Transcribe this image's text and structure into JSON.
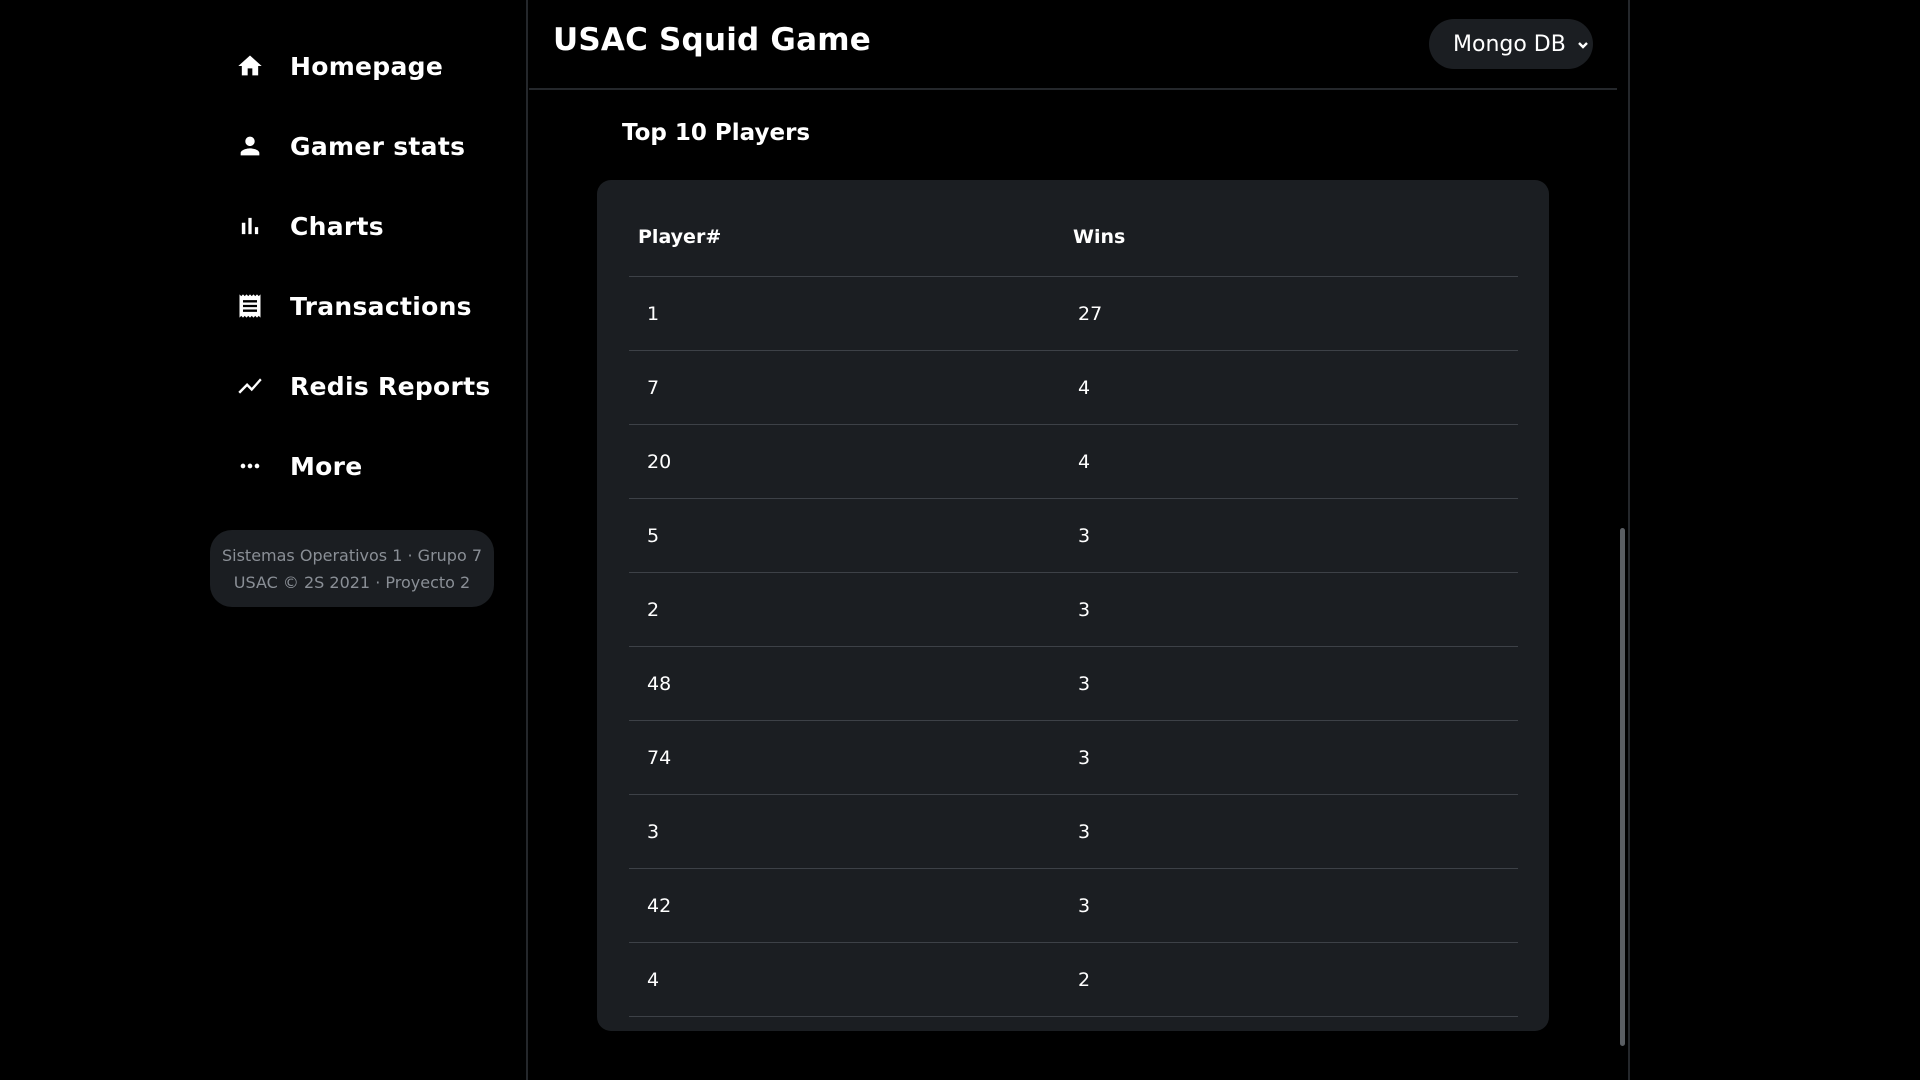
{
  "sidebar": {
    "items": [
      {
        "label": "Homepage",
        "icon": "home-icon"
      },
      {
        "label": "Gamer stats",
        "icon": "person-icon"
      },
      {
        "label": "Charts",
        "icon": "bar-chart-icon"
      },
      {
        "label": "Transactions",
        "icon": "receipt-icon"
      },
      {
        "label": "Redis Reports",
        "icon": "trending-icon"
      },
      {
        "label": "More",
        "icon": "more-icon"
      }
    ],
    "footer": {
      "line1": "Sistemas Operativos 1 · Grupo 7",
      "line2": "USAC © 2S 2021 · Proyecto 2"
    }
  },
  "header": {
    "title": "USAC Squid Game",
    "db_select": {
      "selected": "Mongo DB"
    }
  },
  "main": {
    "section_title": "Top 10 Players",
    "table": {
      "columns": [
        "Player#",
        "Wins"
      ],
      "rows": [
        {
          "player": "1",
          "wins": "27"
        },
        {
          "player": "7",
          "wins": "4"
        },
        {
          "player": "20",
          "wins": "4"
        },
        {
          "player": "5",
          "wins": "3"
        },
        {
          "player": "2",
          "wins": "3"
        },
        {
          "player": "48",
          "wins": "3"
        },
        {
          "player": "74",
          "wins": "3"
        },
        {
          "player": "3",
          "wins": "3"
        },
        {
          "player": "42",
          "wins": "3"
        },
        {
          "player": "4",
          "wins": "2"
        }
      ]
    }
  },
  "colors": {
    "background": "#000000",
    "card": "#1b1e22",
    "divider": "#3d4147",
    "text": "#ffffff",
    "muted_text": "#8a8f96"
  }
}
